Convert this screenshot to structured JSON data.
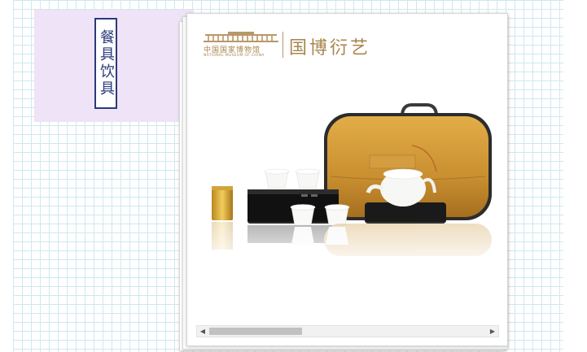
{
  "label": {
    "text": "餐具饮具"
  },
  "brand": {
    "cn_name": "中国国家博物馆",
    "en_name": "NATIONAL MUSEUM OF CHINA",
    "script": "国博衍艺",
    "color": "#a7864e"
  },
  "colors": {
    "label_border": "#2a3a7a",
    "label_panel": "#efe3f7",
    "grid_line": "#cfe8ee",
    "case_orange": "#d19a3a"
  },
  "icons": {
    "scroll_left": "◀",
    "scroll_right": "▶"
  }
}
